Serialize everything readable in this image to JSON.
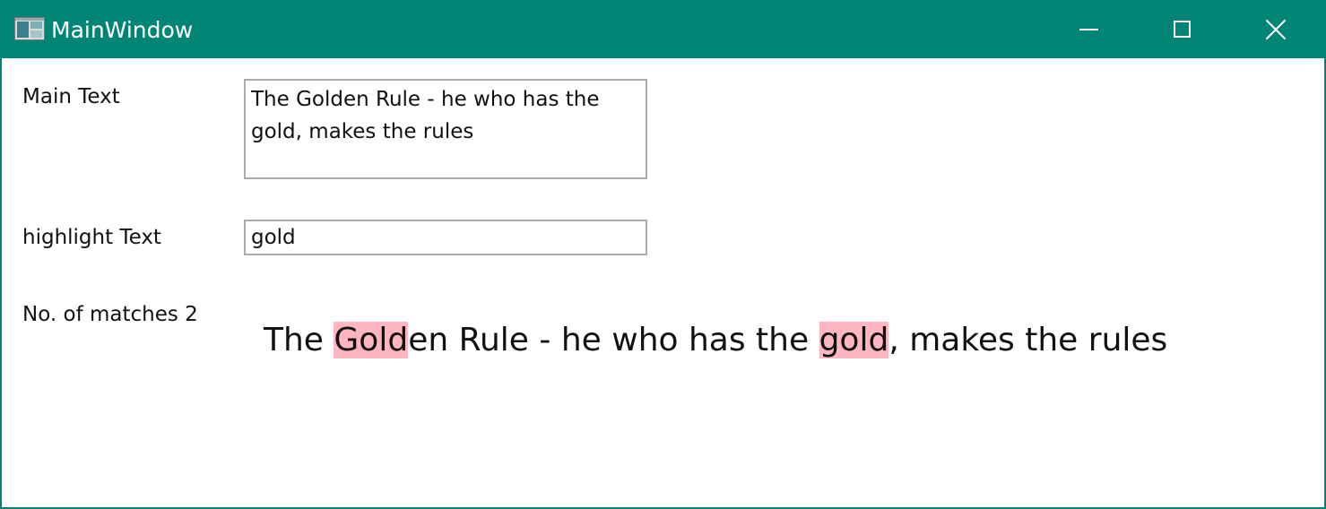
{
  "window": {
    "title": "MainWindow",
    "accent_color": "#028574"
  },
  "caption_buttons": {
    "minimize": "minimize-icon",
    "maximize": "maximize-icon",
    "close": "close-icon"
  },
  "form": {
    "main_text_label": "Main Text",
    "main_text_value": "The Golden Rule - he who has the gold, makes the rules",
    "highlight_text_label": "highlight Text",
    "highlight_text_value": "gold",
    "matches_label": "No. of matches 2"
  },
  "result": {
    "highlight_color": "#ffb6c1",
    "segments": [
      {
        "text": "The ",
        "highlighted": false
      },
      {
        "text": "Gold",
        "highlighted": true
      },
      {
        "text": "en Rule - he who has the ",
        "highlighted": false
      },
      {
        "text": "gold",
        "highlighted": true
      },
      {
        "text": ", makes the rules",
        "highlighted": false
      }
    ]
  }
}
